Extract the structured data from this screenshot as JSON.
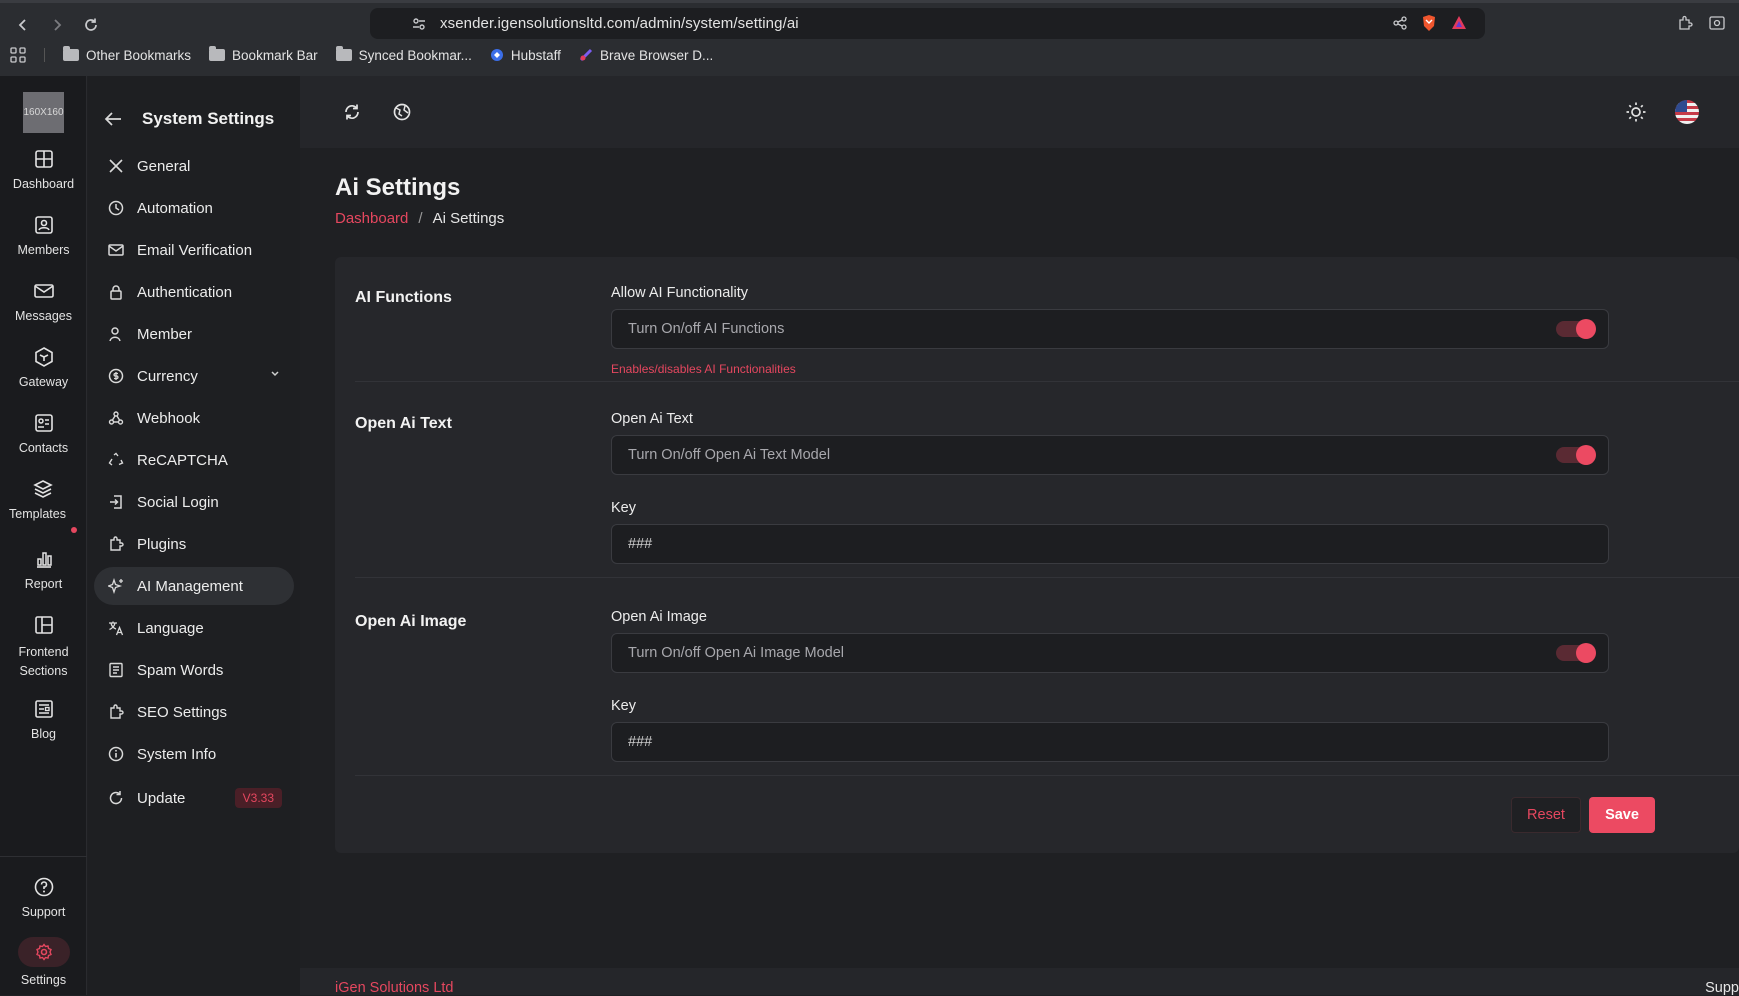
{
  "browser": {
    "url": "xsender.igensolutionsltd.com/admin/system/setting/ai",
    "bookmarks": [
      "Other Bookmarks",
      "Bookmark Bar",
      "Synced Bookmar...",
      "Hubstaff",
      "Brave Browser D..."
    ]
  },
  "rail": {
    "logo_text": "160X160",
    "items": [
      {
        "label": "Dashboard",
        "icon": "dashboard-icon"
      },
      {
        "label": "Members",
        "icon": "members-icon"
      },
      {
        "label": "Messages",
        "icon": "messages-icon"
      },
      {
        "label": "Gateway",
        "icon": "gateway-icon"
      },
      {
        "label": "Contacts",
        "icon": "contacts-icon"
      },
      {
        "label": "Templates",
        "icon": "templates-icon"
      },
      {
        "label": "Report",
        "icon": "report-icon"
      },
      {
        "label": "Frontend Sections",
        "icon": "frontend-icon"
      },
      {
        "label": "Blog",
        "icon": "blog-icon"
      }
    ],
    "support_label": "Support",
    "settings_label": "Settings"
  },
  "sidebar": {
    "title": "System Settings",
    "items": [
      {
        "label": "General"
      },
      {
        "label": "Automation"
      },
      {
        "label": "Email Verification"
      },
      {
        "label": "Authentication"
      },
      {
        "label": "Member"
      },
      {
        "label": "Currency"
      },
      {
        "label": "Webhook"
      },
      {
        "label": "ReCAPTCHA"
      },
      {
        "label": "Social Login"
      },
      {
        "label": "Plugins"
      },
      {
        "label": "AI Management"
      },
      {
        "label": "Language"
      },
      {
        "label": "Spam Words"
      },
      {
        "label": "SEO Settings"
      },
      {
        "label": "System Info"
      },
      {
        "label": "Update"
      }
    ],
    "update_badge": "V3.33",
    "active_item": "AI Management"
  },
  "page": {
    "title": "Ai Settings",
    "breadcrumb_home": "Dashboard",
    "breadcrumb_sep": "/",
    "breadcrumb_current": "Ai Settings"
  },
  "sections": {
    "ai_functions": {
      "title": "AI Functions",
      "label": "Allow AI Functionality",
      "toggle_text": "Turn On/off AI Functions",
      "enabled": true,
      "help": "Enables/disables AI Functionalities"
    },
    "open_ai_text": {
      "title": "Open Ai Text",
      "label": "Open Ai Text",
      "toggle_text": "Turn On/off Open Ai Text Model",
      "enabled": true,
      "key_label": "Key",
      "key_value": "###"
    },
    "open_ai_image": {
      "title": "Open Ai Image",
      "label": "Open Ai Image",
      "toggle_text": "Turn On/off Open Ai Image Model",
      "enabled": true,
      "key_label": "Key",
      "key_value": "###"
    }
  },
  "actions": {
    "reset": "Reset",
    "save": "Save"
  },
  "footer": {
    "left": "iGen Solutions Ltd",
    "right": "Supp"
  },
  "colors": {
    "accent": "#ec4a62",
    "background": "#1f2023",
    "card": "#26272b"
  }
}
